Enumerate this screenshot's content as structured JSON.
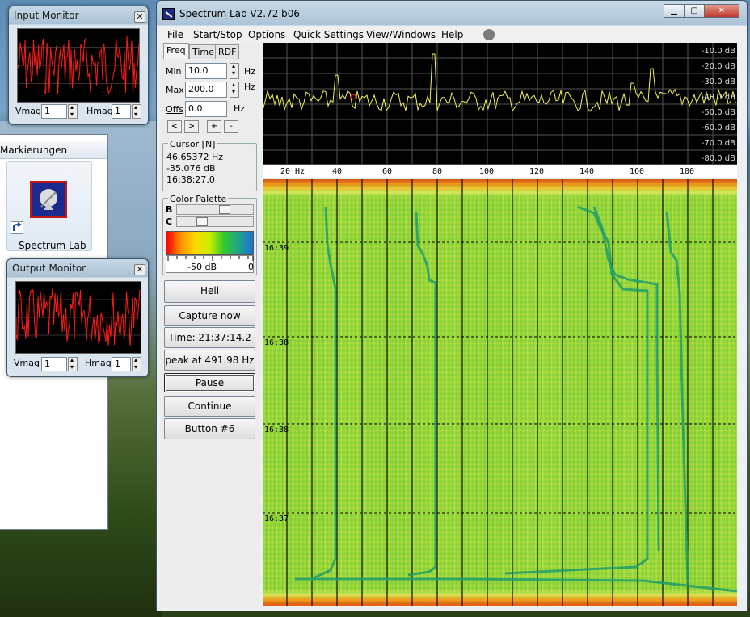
{
  "input_monitor": {
    "title": "Input Monitor",
    "vmag_label": "Vmag",
    "vmag_value": "1",
    "hmag_label": "Hmag",
    "hmag_value": "1"
  },
  "output_monitor": {
    "title": "Output Monitor",
    "vmag_label": "Vmag",
    "vmag_value": "1",
    "hmag_label": "Hmag",
    "hmag_value": "1"
  },
  "explorer": {
    "toolbar_label": "Markierungen",
    "shortcut_label": "Spectrum Lab"
  },
  "main_window": {
    "title": "Spectrum Lab V2.72 b06",
    "menu": [
      "File",
      "Start/Stop",
      "Options",
      "Quick Settings",
      "View/Windows",
      "Help"
    ],
    "tabs": [
      "Freq",
      "Time",
      "RDF"
    ],
    "freq": {
      "min_label": "Min",
      "min_value": "10.0",
      "min_unit": "Hz",
      "max_label": "Max",
      "max_value": "200.0",
      "max_unit": "Hz",
      "offs_label": "Offs",
      "offs_value": "0.0",
      "offs_unit": "Hz",
      "nav_buttons": [
        "<",
        ">",
        "+",
        "-"
      ]
    },
    "cursor": {
      "group_title": "Cursor [N]",
      "freq": "46.65372 Hz",
      "level": "-35.076 dB",
      "time": "16:38:27.0"
    },
    "palette": {
      "group_title": "Color Palette",
      "b_label": "B",
      "c_label": "C",
      "scale_left": "-50 dB",
      "scale_right": "0"
    },
    "buttons": [
      "Heli",
      "Capture now",
      "Time:  21:37:14.2",
      "peak at 491.98 Hz",
      "Pause",
      "Continue",
      "Button #6"
    ],
    "db_labels": [
      "-10.0 dB",
      "-20.0 dB",
      "-30.0 dB",
      "-40.0 dB",
      "-50.0 dB",
      "-60.0 dB",
      "-70.0 dB",
      "-80.0 dB"
    ],
    "freq_labels": [
      "20 Hz",
      "40",
      "60",
      "80",
      "100",
      "120",
      "140",
      "160",
      "180"
    ],
    "time_labels": [
      "16:39",
      "16:38",
      "16:38",
      "16:37"
    ]
  },
  "colors": {
    "spectrum_line": "#f2f25a",
    "monitor_trace": "#ff1a1a",
    "waterfall_base": "#98d83a",
    "trace_green": "#1f9e6a"
  }
}
